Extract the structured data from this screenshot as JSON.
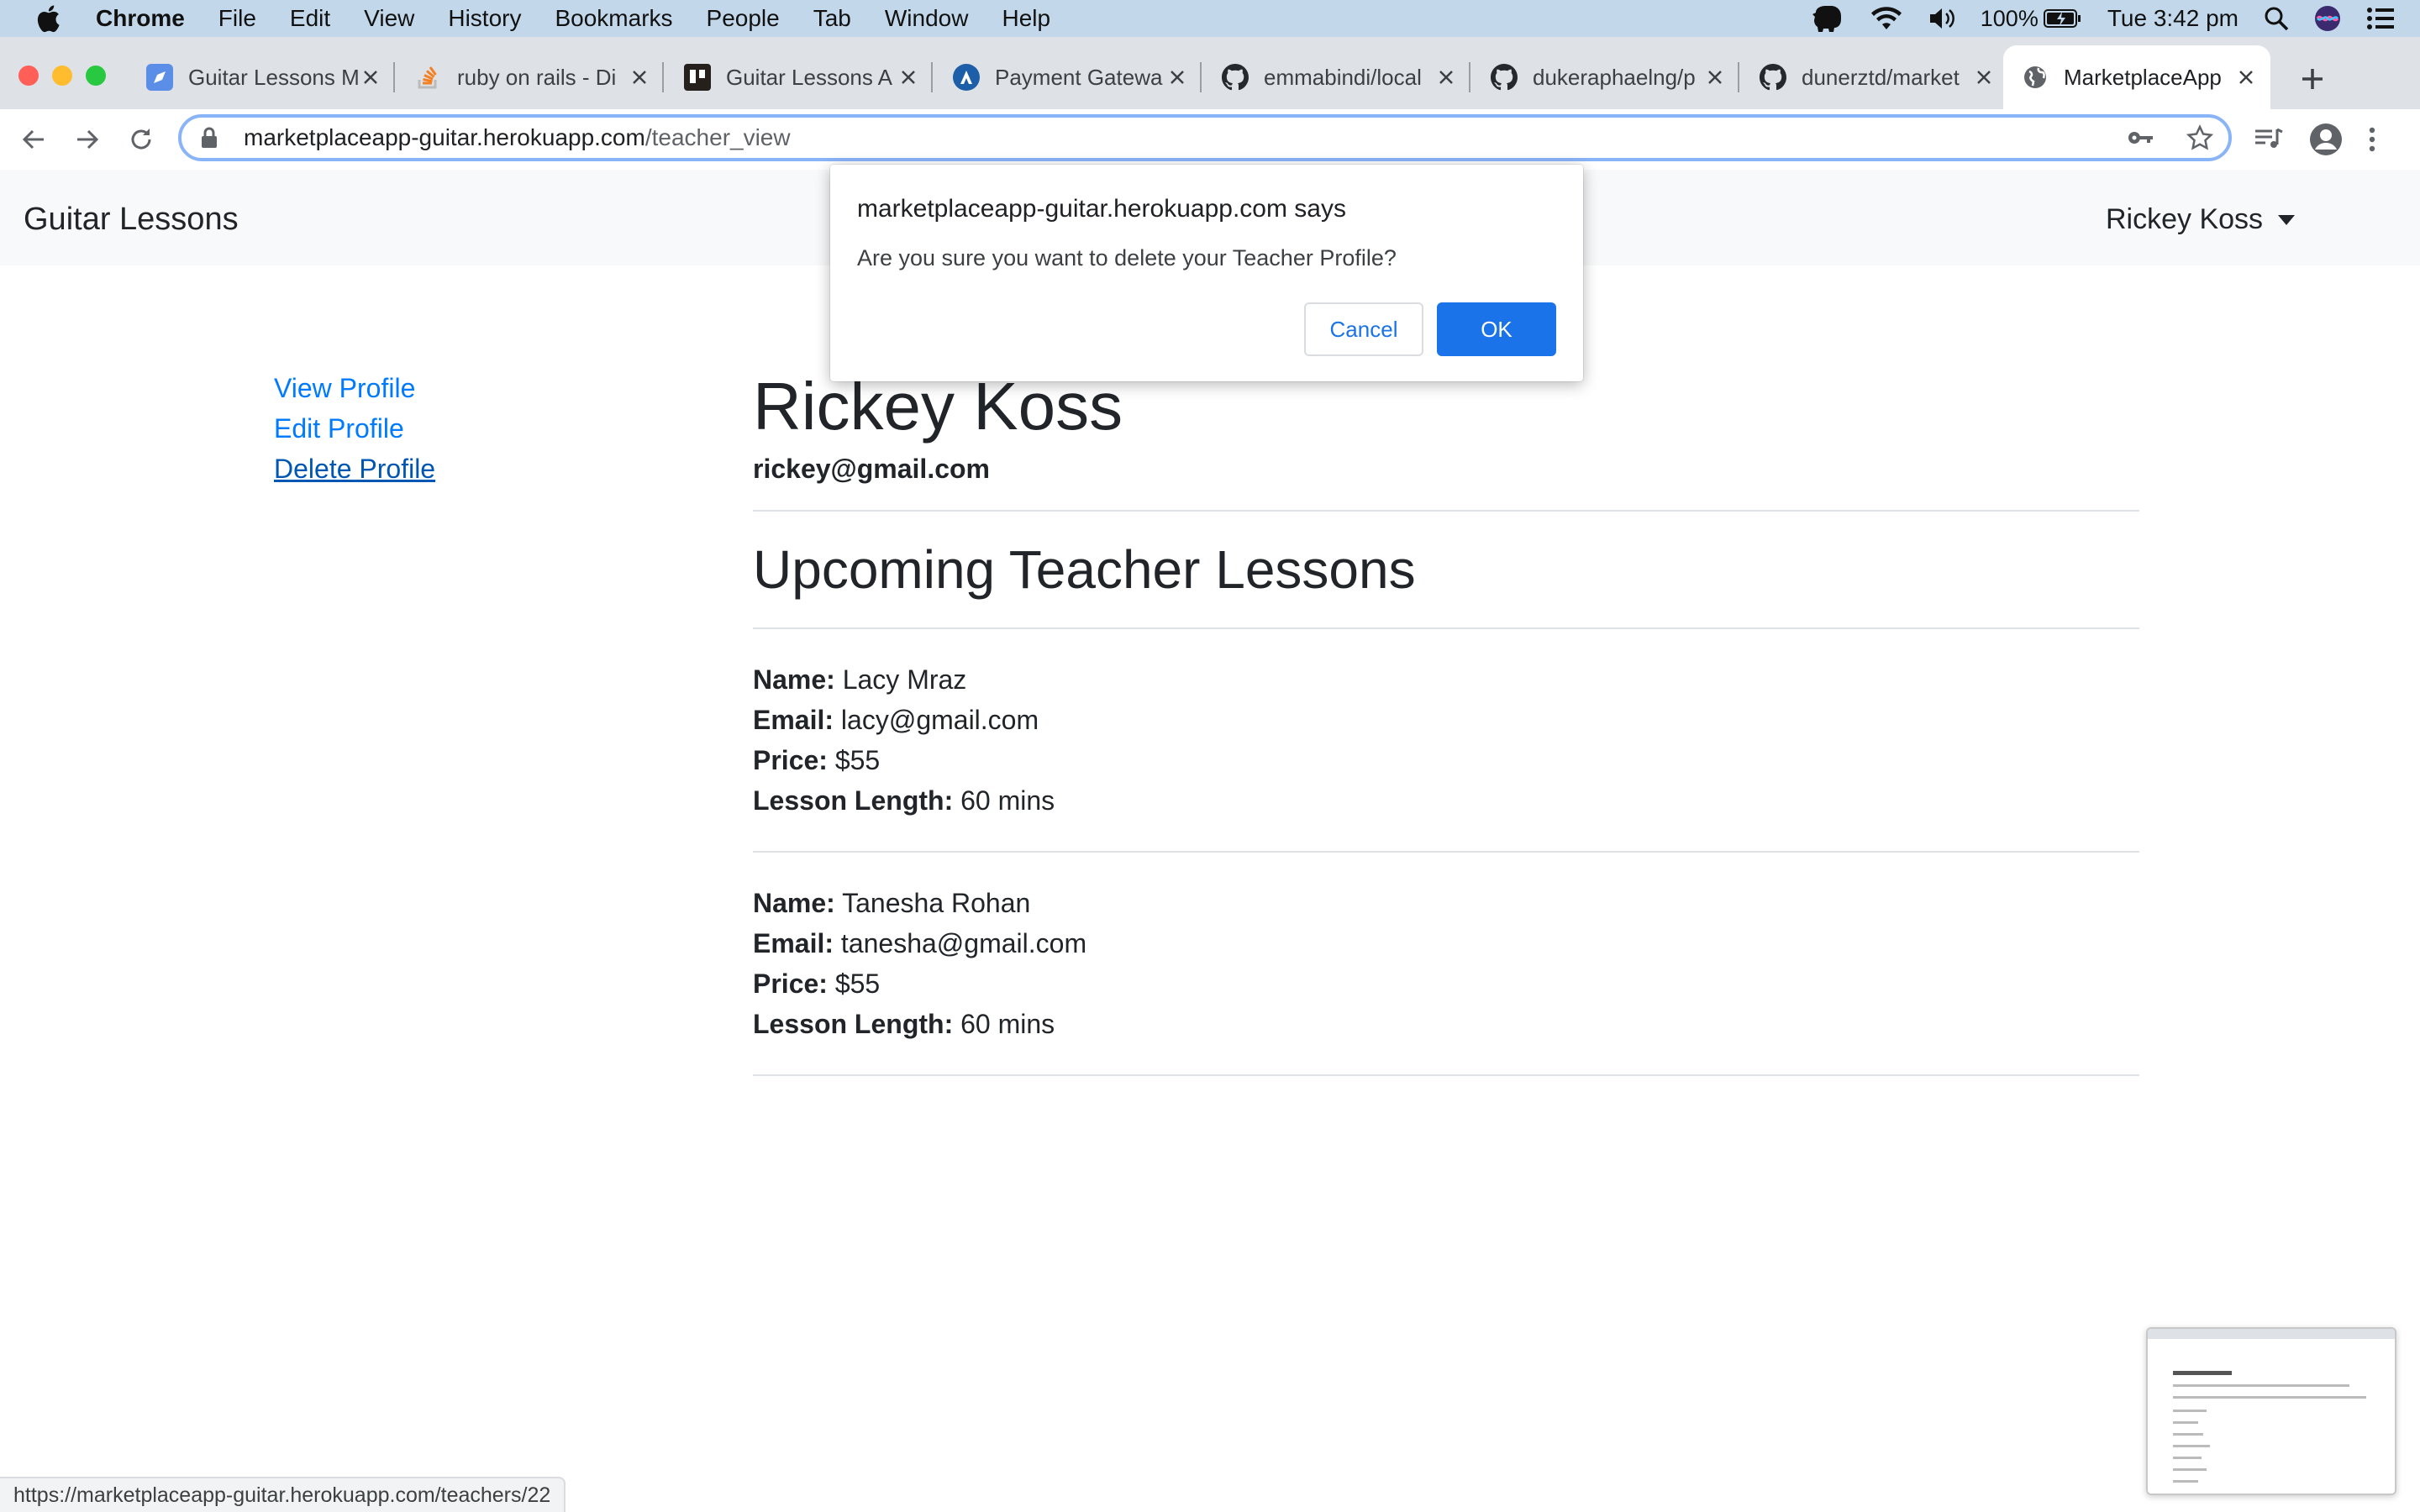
{
  "menubar": {
    "app_name": "Chrome",
    "items": [
      "File",
      "Edit",
      "View",
      "History",
      "Bookmarks",
      "People",
      "Tab",
      "Window",
      "Help"
    ],
    "battery": "100%",
    "clock": "Tue 3:42 pm"
  },
  "tabs": [
    {
      "title": "Guitar Lessons M",
      "icon": "guitar-lessons-favicon"
    },
    {
      "title": "ruby on rails - Di",
      "icon": "stackoverflow-favicon"
    },
    {
      "title": "Guitar Lessons A",
      "icon": "trello-favicon"
    },
    {
      "title": "Payment Gatewa",
      "icon": "payment-favicon"
    },
    {
      "title": "emmabindi/local",
      "icon": "github-favicon"
    },
    {
      "title": "dukeraphaelng/p",
      "icon": "github-favicon"
    },
    {
      "title": "dunerztd/market",
      "icon": "github-favicon"
    },
    {
      "title": "MarketplaceApp",
      "icon": "globe-favicon"
    }
  ],
  "address_bar": {
    "host": "marketplaceapp-guitar.herokuapp.com",
    "path": "/teacher_view"
  },
  "site": {
    "brand": "Guitar Lessons",
    "user_menu": "Rickey Koss"
  },
  "sidebar": {
    "items": [
      "View Profile",
      "Edit Profile",
      "Delete Profile"
    ]
  },
  "profile": {
    "name": "Rickey Koss",
    "email": "rickey@gmail.com"
  },
  "lessons_section": {
    "heading": "Upcoming Teacher Lessons",
    "labels": {
      "name": "Name:",
      "email": "Email:",
      "price": "Price:",
      "length": "Lesson Length:"
    },
    "lessons": [
      {
        "name": "Lacy Mraz",
        "email": "lacy@gmail.com",
        "price": "$55",
        "length": "60 mins"
      },
      {
        "name": "Tanesha Rohan",
        "email": "tanesha@gmail.com",
        "price": "$55",
        "length": "60 mins"
      }
    ]
  },
  "dialog": {
    "title": "marketplaceapp-guitar.herokuapp.com says",
    "message": "Are you sure you want to delete your Teacher Profile?",
    "cancel": "Cancel",
    "ok": "OK"
  },
  "status_bar": {
    "url": "https://marketplaceapp-guitar.herokuapp.com/teachers/22"
  },
  "colors": {
    "link": "#007bff",
    "dialog_ok": "#1a73e8",
    "menubar": "#c2d8ea",
    "tabstrip": "#dee1e6"
  }
}
